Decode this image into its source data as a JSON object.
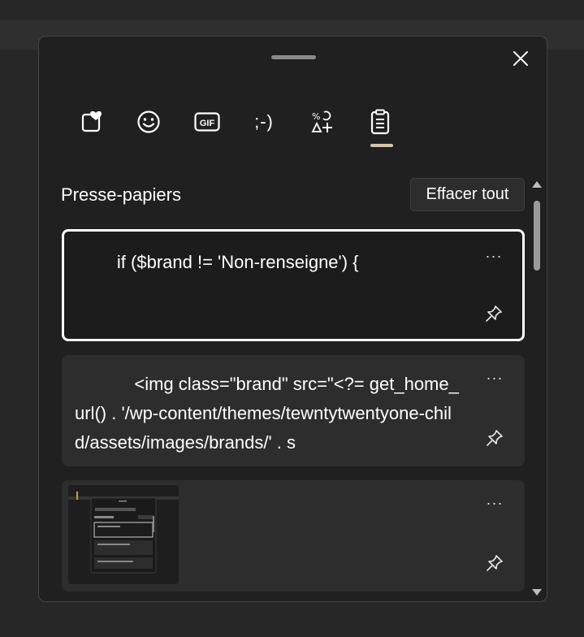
{
  "panel": {
    "tabs": [
      {
        "name": "favorites",
        "icon": "heart-sticker-icon"
      },
      {
        "name": "emoji",
        "icon": "smiley-icon"
      },
      {
        "name": "gif",
        "icon": "gif-icon",
        "label": "GIF"
      },
      {
        "name": "kaomoji",
        "icon": "kaomoji-icon",
        "label": ";-)"
      },
      {
        "name": "symbols",
        "icon": "symbols-icon"
      },
      {
        "name": "clipboard",
        "icon": "clipboard-icon",
        "selected": true
      }
    ],
    "accent_color": "#d3c4ae"
  },
  "clipboard": {
    "heading": "Presse-papiers",
    "clear_all_label": "Effacer tout",
    "items": [
      {
        "text": "\t\tif ($brand != 'Non-renseigne') {",
        "selected": true,
        "more_label": "···"
      },
      {
        "text": "\t\t\t<img class=\"brand\" src=\"<?= get_home_url() . '/wp-content/themes/tewntytwentyone-child/assets/images/brands/' . s",
        "selected": false,
        "more_label": "···"
      },
      {
        "type": "image",
        "preview": "screenshot-thumbnail",
        "more_label": "···"
      }
    ]
  }
}
